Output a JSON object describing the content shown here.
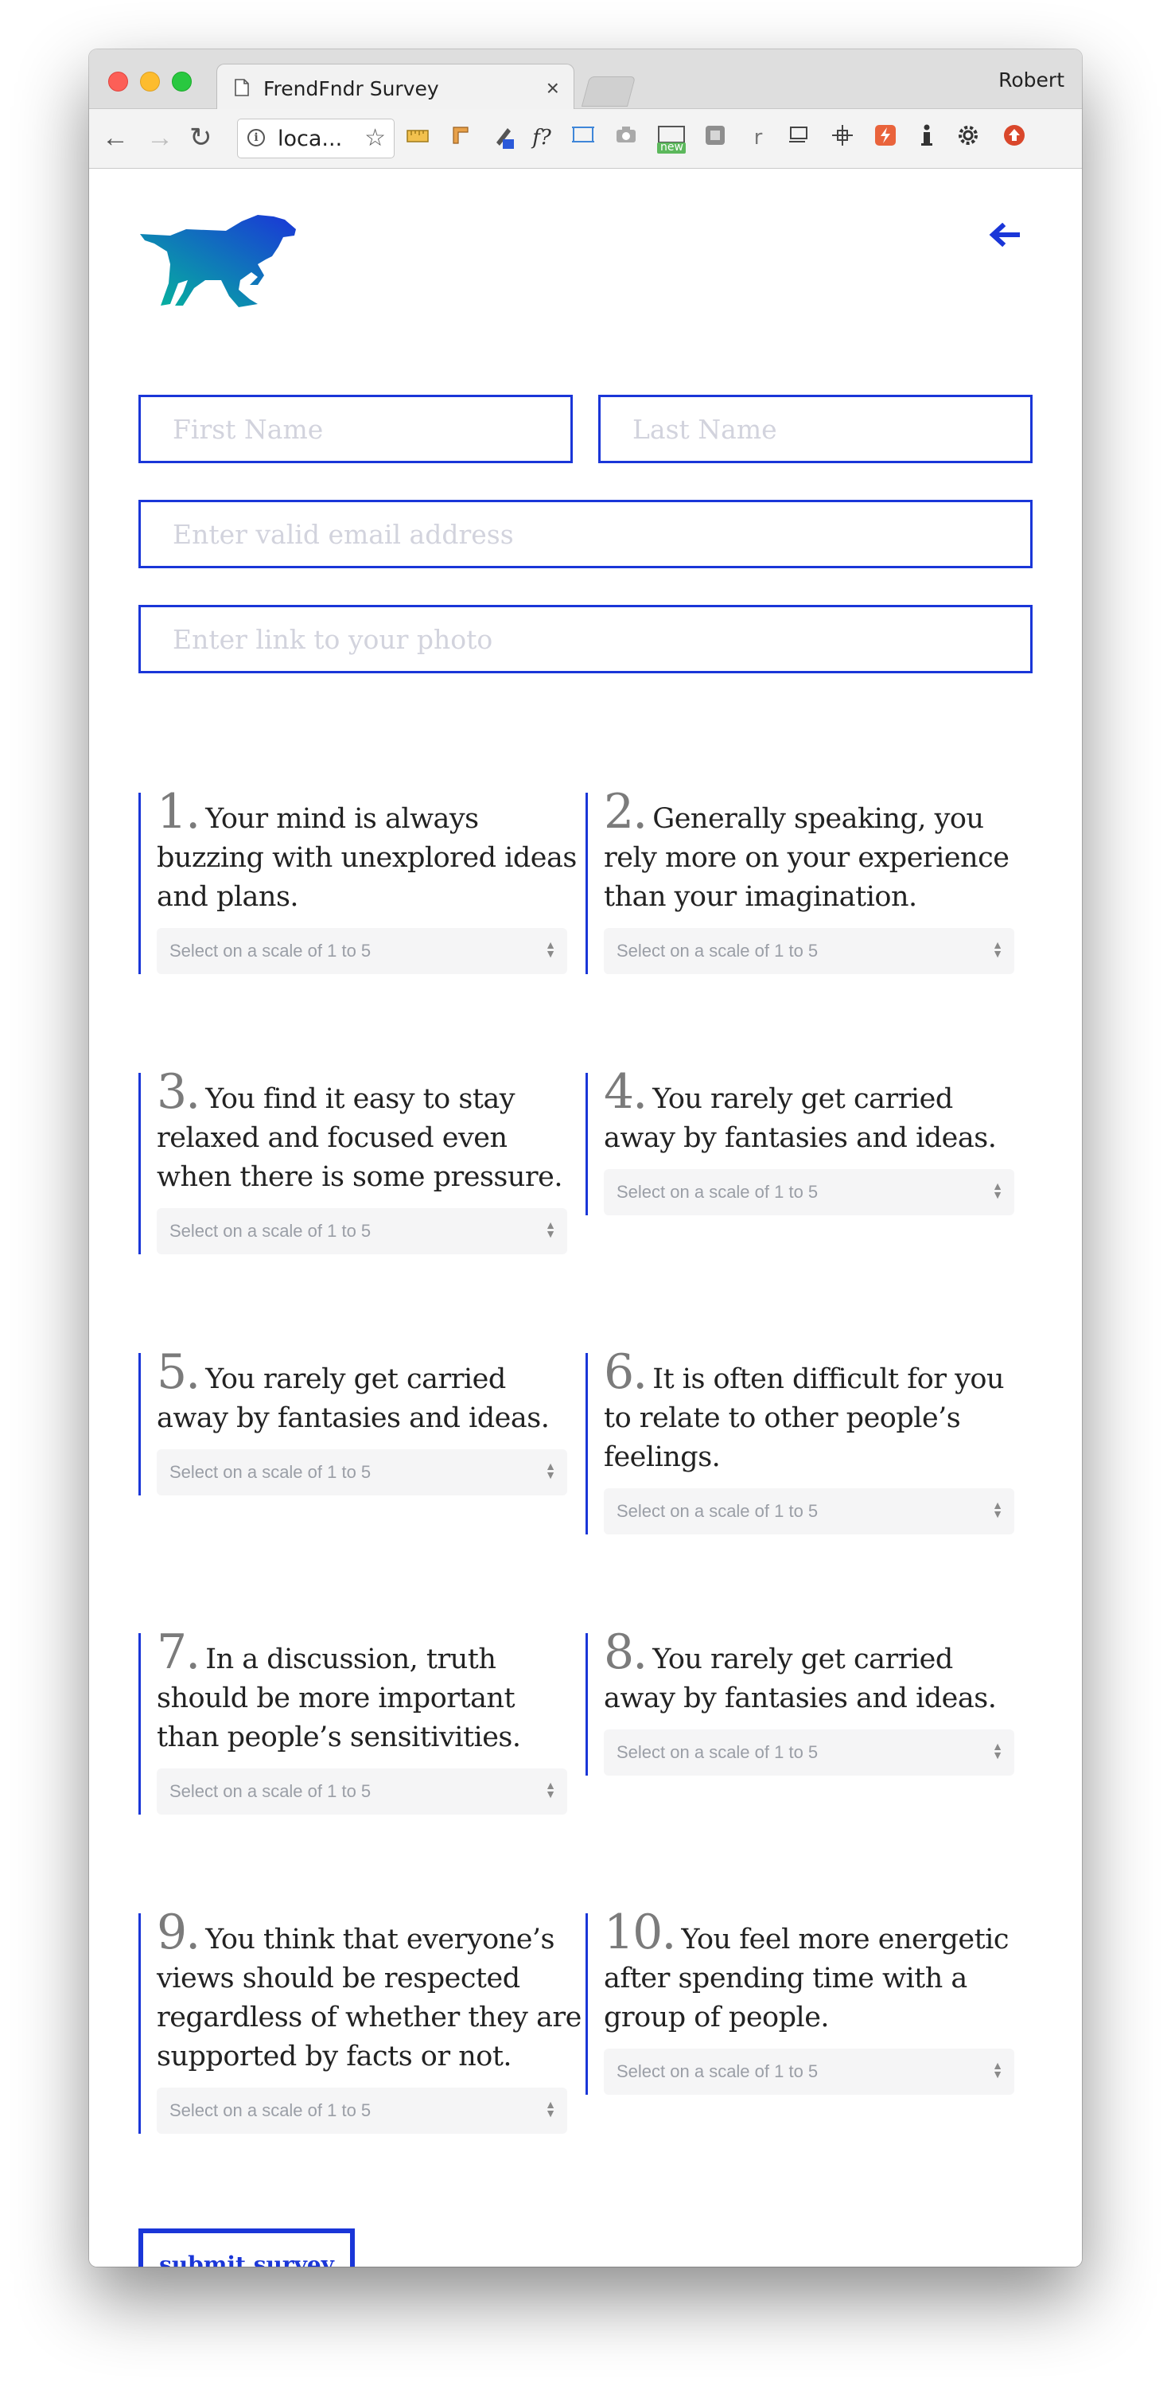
{
  "browser": {
    "tab_title": "FrendFndr Survey",
    "profile_name": "Robert",
    "url": "loca...",
    "tab_close_glyph": "×",
    "extensions_text": [
      "f?",
      "r"
    ],
    "new_badge": "new"
  },
  "form": {
    "first_name_placeholder": "First Name",
    "last_name_placeholder": "Last Name",
    "email_placeholder": "Enter valid email address",
    "photo_placeholder": "Enter link to your photo"
  },
  "questions": [
    {
      "num": "1.",
      "text": "Your mind is always buzzing with unexplored ideas and plans.",
      "select": "Select on a scale of 1 to 5"
    },
    {
      "num": "2.",
      "text": "Generally speaking, you rely more on your experience than your imagination.",
      "select": "Select on a scale of 1 to 5"
    },
    {
      "num": "3.",
      "text": "You find it easy to stay relaxed and focused even when there is some pressure.",
      "select": "Select on a scale of 1 to 5"
    },
    {
      "num": "4.",
      "text": "You rarely get carried away by fantasies and ideas.",
      "select": "Select on a scale of 1 to 5"
    },
    {
      "num": "5.",
      "text": "You rarely get carried away by fantasies and ideas.",
      "select": "Select on a scale of 1 to 5"
    },
    {
      "num": "6.",
      "text": "It is often difficult for you to relate to other people’s feelings.",
      "select": "Select on a scale of 1 to 5"
    },
    {
      "num": "7.",
      "text": "In a discussion, truth should be more important than people’s sensitivities.",
      "select": "Select on a scale of 1 to 5"
    },
    {
      "num": "8.",
      "text": "You rarely get carried away by fantasies and ideas.",
      "select": "Select on a scale of 1 to 5"
    },
    {
      "num": "9.",
      "text": "You think that everyone’s views should be respected regardless of whether they are supported by facts or not.",
      "select": "Select on a scale of 1 to 5"
    },
    {
      "num": "10.",
      "text": "You feel more energetic after spending time with a group of people.",
      "select": "Select on a scale of 1 to 5"
    }
  ],
  "submit_label": "submit survey",
  "colors": {
    "accent": "#1a36d8",
    "logo_gradient_start": "#05b99b",
    "logo_gradient_end": "#1a36d8"
  }
}
